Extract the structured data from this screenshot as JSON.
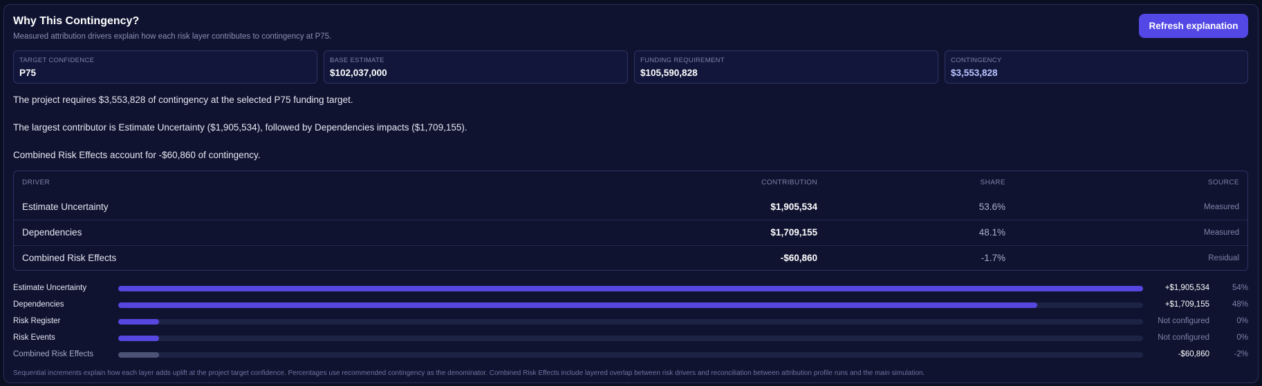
{
  "header": {
    "title": "Why This Contingency?",
    "subtitle": "Measured attribution drivers explain how each risk layer contributes to contingency at P75.",
    "refresh_label": "Refresh explanation"
  },
  "kpis": [
    {
      "label": "TARGET CONFIDENCE",
      "value": "P75"
    },
    {
      "label": "BASE ESTIMATE",
      "value": "$102,037,000"
    },
    {
      "label": "FUNDING REQUIREMENT",
      "value": "$105,590,828"
    },
    {
      "label": "CONTINGENCY",
      "value": "$3,553,828"
    }
  ],
  "summary": [
    "The project requires $3,553,828 of contingency at the selected P75 funding target.",
    "The largest contributor is Estimate Uncertainty ($1,905,534), followed by Dependencies impacts ($1,709,155).",
    "Combined Risk Effects account for -$60,860 of contingency."
  ],
  "table": {
    "headers": {
      "driver": "DRIVER",
      "contribution": "CONTRIBUTION",
      "share": "SHARE",
      "source": "SOURCE"
    },
    "rows": [
      {
        "driver": "Estimate Uncertainty",
        "contribution": "$1,905,534",
        "share": "53.6%",
        "source": "Measured"
      },
      {
        "driver": "Dependencies",
        "contribution": "$1,709,155",
        "share": "48.1%",
        "source": "Measured"
      },
      {
        "driver": "Combined Risk Effects",
        "contribution": "-$60,860",
        "share": "-1.7%",
        "source": "Residual"
      }
    ]
  },
  "bars": [
    {
      "label": "Estimate Uncertainty",
      "value": "+$1,905,534",
      "pct": "54%",
      "fill": 1.0,
      "kind": "measured"
    },
    {
      "label": "Dependencies",
      "value": "+$1,709,155",
      "pct": "48%",
      "fill": 0.897,
      "kind": "measured"
    },
    {
      "label": "Risk Register",
      "value": "Not configured",
      "pct": "0%",
      "fill": 0.04,
      "kind": "unconfigured"
    },
    {
      "label": "Risk Events",
      "value": "Not configured",
      "pct": "0%",
      "fill": 0.04,
      "kind": "unconfigured"
    },
    {
      "label": "Combined Risk Effects",
      "value": "-$60,860",
      "pct": "-2%",
      "fill": 0.04,
      "kind": "residual"
    }
  ],
  "footnote": "Sequential increments explain how each layer adds uplift at the project target confidence. Percentages use recommended contingency as the denominator. Combined Risk Effects include layered overlap between risk drivers and reconciliation between attribution profile runs and the main simulation.",
  "colors": {
    "accent": "#5347e6",
    "bar": "#5547e0",
    "residual_bar": "#4b5273",
    "track": "#1d2344"
  }
}
